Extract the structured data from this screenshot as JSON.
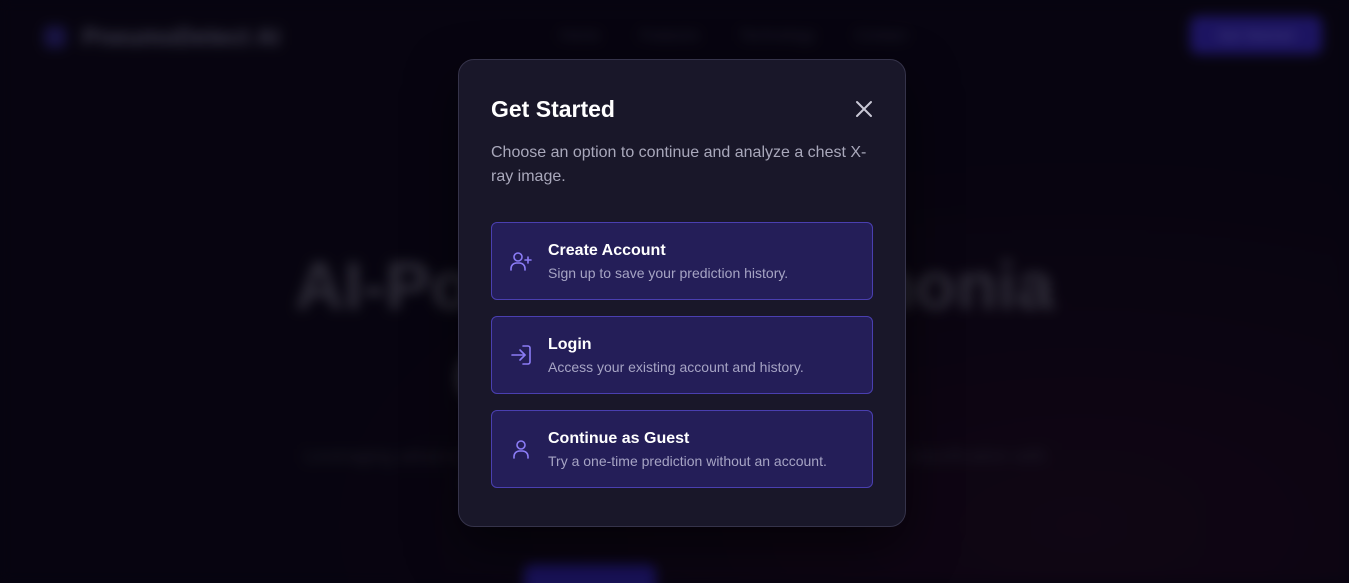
{
  "background": {
    "brand": "PneumoDetect AI",
    "nav_links": [
      "Home",
      "Features",
      "Technology",
      "Contact"
    ],
    "cta": "Get Started",
    "hero_line1": "AI-Powered Pneumonia",
    "hero_line2": "Classification",
    "hero_sub": "Leveraging advanced deep learning to analyze chest X-rays for pneumonia classification with high accuracy and speed to support clinical decisions."
  },
  "modal": {
    "title": "Get Started",
    "description": "Choose an option to continue and analyze a chest X-ray image.",
    "options": [
      {
        "title": "Create Account",
        "subtitle": "Sign up to save your prediction history.",
        "icon": "user-plus-icon"
      },
      {
        "title": "Login",
        "subtitle": "Access your existing account and history.",
        "icon": "login-icon"
      },
      {
        "title": "Continue as Guest",
        "subtitle": "Try a one-time prediction without an account.",
        "icon": "user-icon"
      }
    ]
  },
  "colors": {
    "accent": "#8b7cf6",
    "option_bg": "#241e58",
    "option_border": "#4a3fb0",
    "modal_bg": "#191729"
  }
}
